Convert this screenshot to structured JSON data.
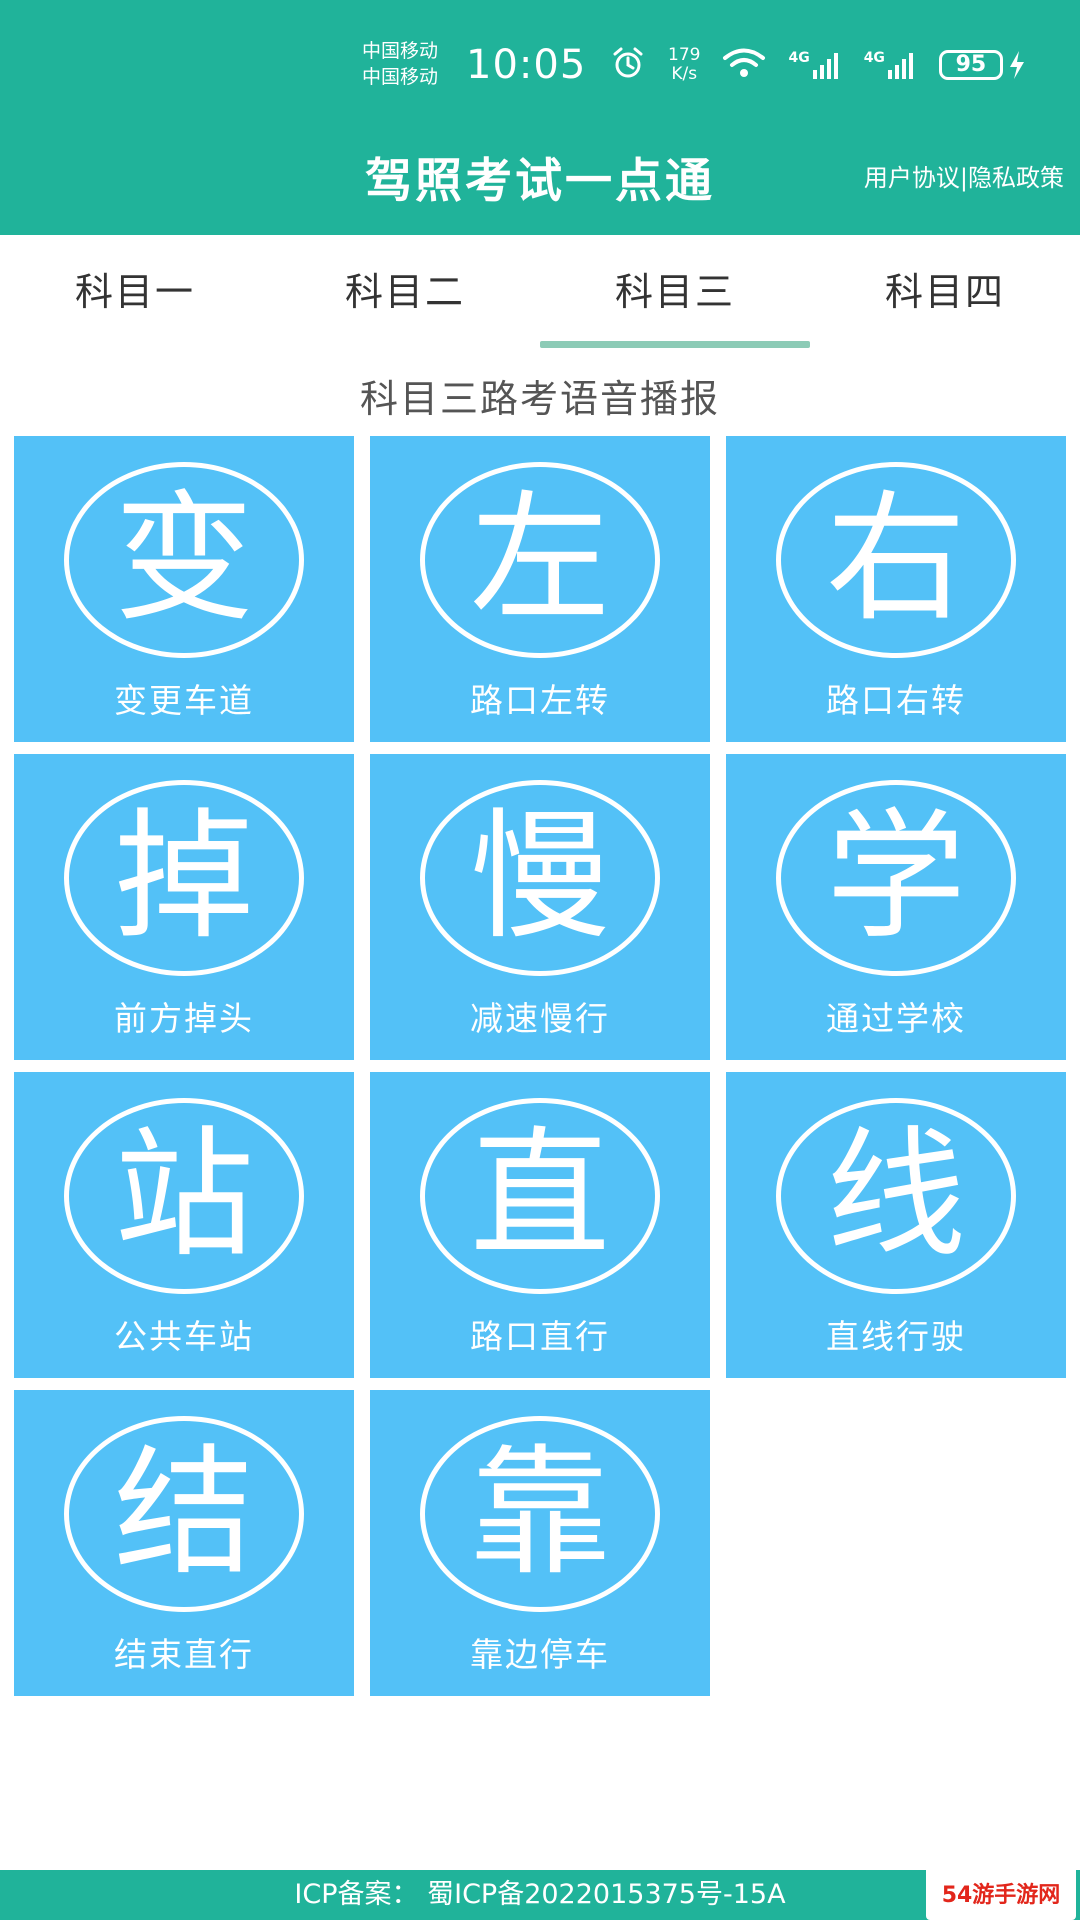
{
  "status_bar": {
    "carrier_1": "中国移动",
    "carrier_2": "中国移动",
    "time": "10:05",
    "net_speed_value": "179",
    "net_speed_unit": "K/s",
    "signal_1_label": "4G",
    "signal_2_label": "4G",
    "battery": "95"
  },
  "header": {
    "title": "驾照考试一点通",
    "links": "用户协议|隐私政策"
  },
  "tabs": [
    {
      "label": "科目一",
      "active": false
    },
    {
      "label": "科目二",
      "active": false
    },
    {
      "label": "科目三",
      "active": true
    },
    {
      "label": "科目四",
      "active": false
    }
  ],
  "section_title": "科目三路考语音播报",
  "items": [
    {
      "glyph": "变",
      "label": "变更车道"
    },
    {
      "glyph": "左",
      "label": "路口左转"
    },
    {
      "glyph": "右",
      "label": "路口右转"
    },
    {
      "glyph": "掉",
      "label": "前方掉头"
    },
    {
      "glyph": "慢",
      "label": "减速慢行"
    },
    {
      "glyph": "学",
      "label": "通过学校"
    },
    {
      "glyph": "站",
      "label": "公共车站"
    },
    {
      "glyph": "直",
      "label": "路口直行"
    },
    {
      "glyph": "线",
      "label": "直线行驶"
    },
    {
      "glyph": "结",
      "label": "结束直行"
    },
    {
      "glyph": "靠",
      "label": "靠边停车"
    }
  ],
  "footer": {
    "icp": "ICP备案： 蜀ICP备2022015375号-15A"
  },
  "watermark": "54游手游网",
  "colors": {
    "header_bg": "#20b39a",
    "tile_bg": "#53c1f7",
    "tab_indicator": "#8ccbb6"
  }
}
